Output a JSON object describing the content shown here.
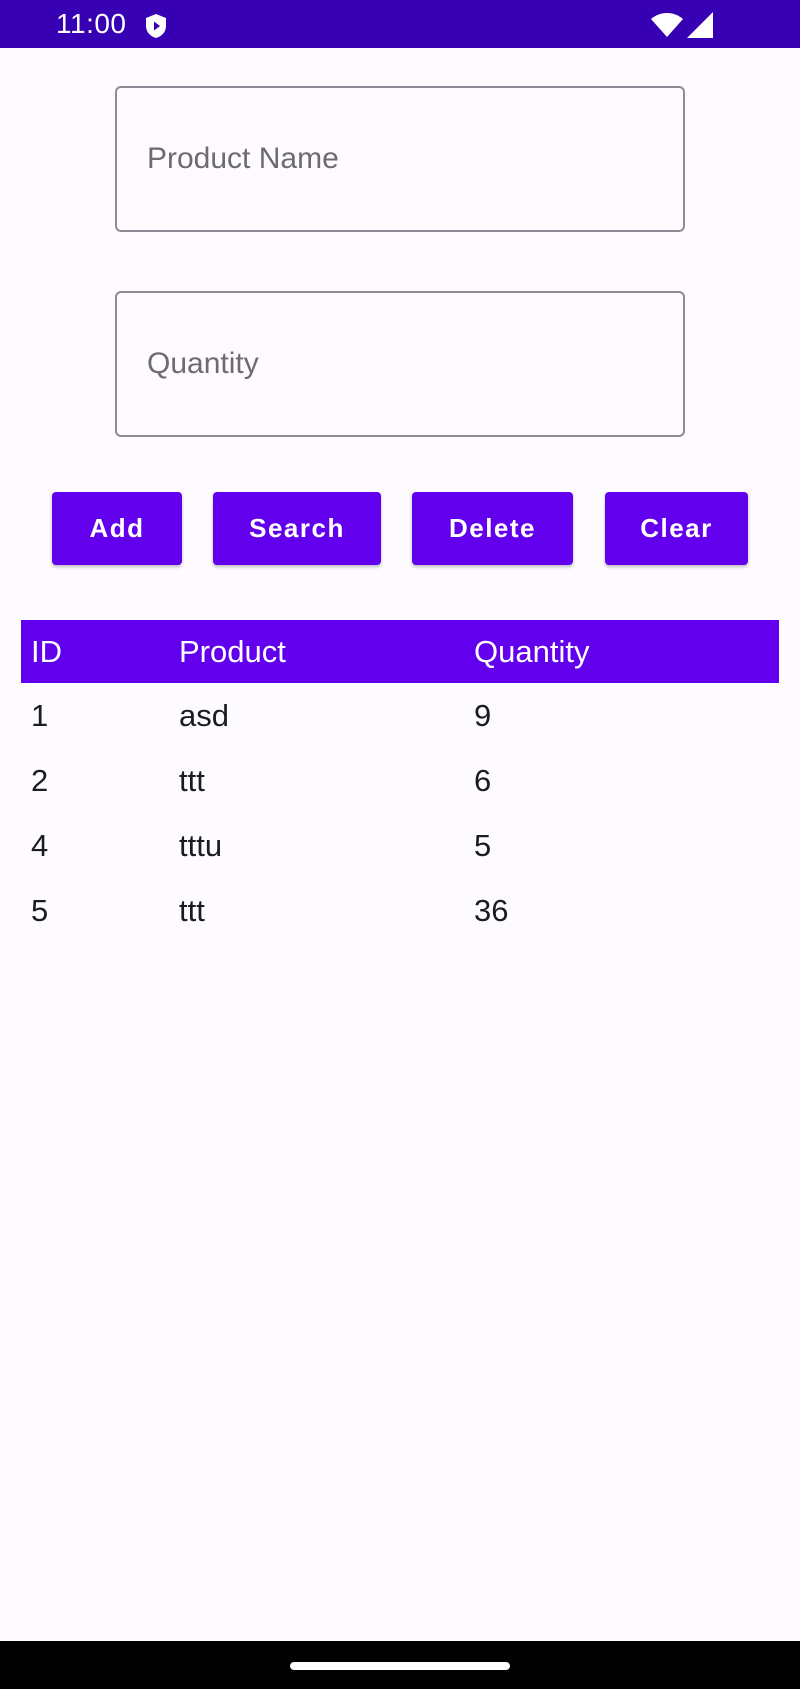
{
  "status_bar": {
    "time": "11:00",
    "icons": [
      "shield-icon",
      "wifi-icon",
      "signal-icon"
    ],
    "color": "#3700b3"
  },
  "form": {
    "product_name": {
      "placeholder": "Product Name",
      "value": ""
    },
    "quantity": {
      "placeholder": "Quantity",
      "value": ""
    }
  },
  "buttons": {
    "add": "Add",
    "search": "Search",
    "delete": "Delete",
    "clear": "Clear",
    "color": "#6200ee"
  },
  "table": {
    "headers": [
      "ID",
      "Product",
      "Quantity"
    ],
    "rows": [
      [
        "1",
        "asd",
        "9"
      ],
      [
        "2",
        "ttt",
        "6"
      ],
      [
        "4",
        "tttu",
        "5"
      ],
      [
        "5",
        "ttt",
        "36"
      ]
    ]
  }
}
